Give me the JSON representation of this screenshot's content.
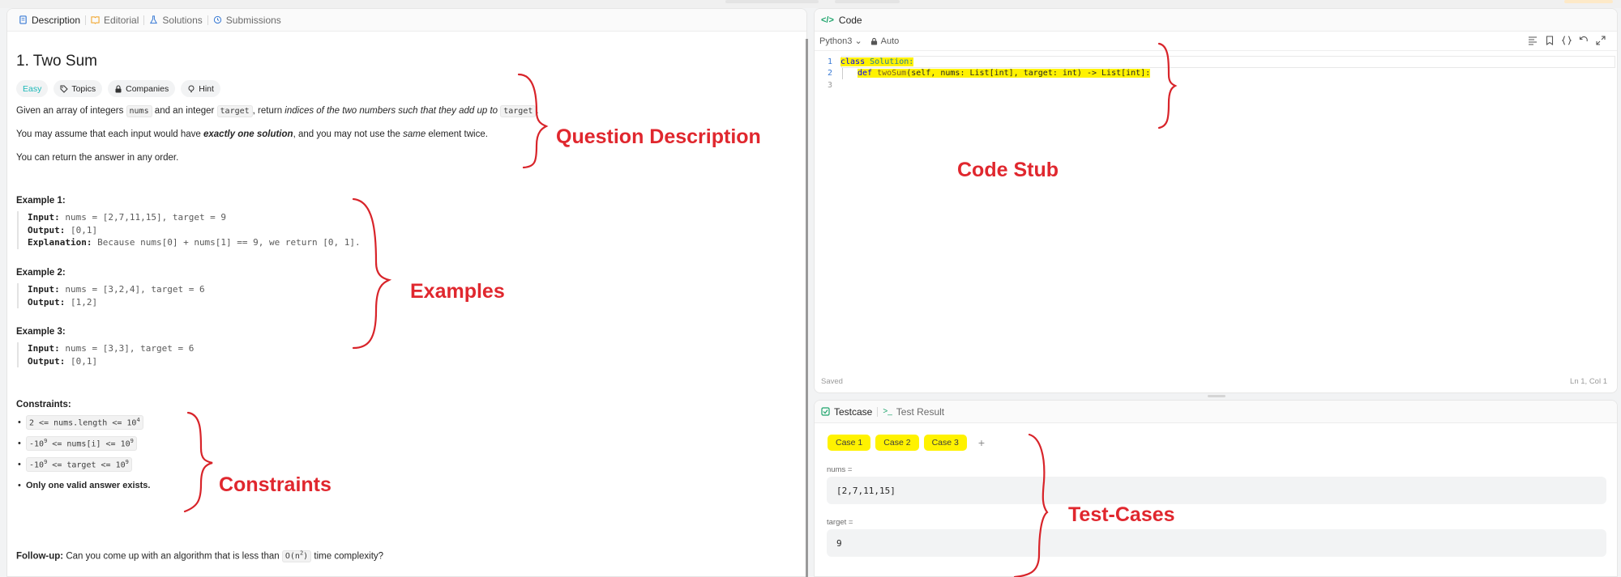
{
  "left_panel": {
    "tabs": [
      {
        "label": "Description",
        "icon": "description-icon"
      },
      {
        "label": "Editorial",
        "icon": "book-icon"
      },
      {
        "label": "Solutions",
        "icon": "flask-icon"
      },
      {
        "label": "Submissions",
        "icon": "history-icon"
      }
    ],
    "title": "1. Two Sum",
    "chips": {
      "difficulty": "Easy",
      "topics": "Topics",
      "companies": "Companies",
      "hint": "Hint"
    },
    "description": {
      "p1_pre": "Given an array of integers ",
      "p1_code1": "nums",
      "p1_mid": " and an integer ",
      "p1_code2": "target",
      "p1_mid2": ", return ",
      "p1_em": "indices of the two numbers such that they add up to",
      "p1_code3": "target",
      "p1_end": ".",
      "p2_pre": "You may assume that each input would have ",
      "p2_bold": "exactly one solution",
      "p2_mid": ", and you may not use the ",
      "p2_em": "same",
      "p2_end": " element twice.",
      "p3": "You can return the answer in any order."
    },
    "examples": [
      {
        "heading": "Example 1:",
        "input": "nums = [2,7,11,15], target = 9",
        "output": "[0,1]",
        "explanation": "Because nums[0] + nums[1] == 9, we return [0, 1]."
      },
      {
        "heading": "Example 2:",
        "input": "nums = [3,2,4], target = 6",
        "output": "[1,2]"
      },
      {
        "heading": "Example 3:",
        "input": "nums = [3,3], target = 6",
        "output": "[0,1]"
      }
    ],
    "labels": {
      "input": "Input:",
      "output": "Output:",
      "explanation": "Explanation:"
    },
    "constraints_heading": "Constraints:",
    "constraints": {
      "c1_a": "2 <= nums.length <= 10",
      "c1_sup": "4",
      "c2_a": "-10",
      "c2_sup1": "9",
      "c2_b": " <= nums[i] <= 10",
      "c2_sup2": "9",
      "c3_a": "-10",
      "c3_sup1": "9",
      "c3_b": " <= target <= 10",
      "c3_sup2": "9",
      "c4": "Only one valid answer exists."
    },
    "followup": {
      "label": "Follow-up:",
      "pre": " Can you come up with an algorithm that is less than ",
      "code": "O(n",
      "code_sup": "2",
      "code_end": ")",
      "post": " time complexity?"
    }
  },
  "code_panel": {
    "title": "Code",
    "language": "Python3",
    "mode": "Auto",
    "lines": [
      {
        "num": "1",
        "kw": "class",
        "rest": " Solution:"
      },
      {
        "num": "2",
        "kw": "def",
        "fn": " twoSum",
        "rest": "(self, nums: List[int], target: int) -> List[int]:"
      },
      {
        "num": "3"
      }
    ],
    "status_left": "Saved",
    "status_right": "Ln 1, Col 1"
  },
  "test_panel": {
    "tab_testcase": "Testcase",
    "tab_result": "Test Result",
    "cases": [
      "Case 1",
      "Case 2",
      "Case 3"
    ],
    "plus": "+",
    "fields": [
      {
        "label": "nums =",
        "value": "[2,7,11,15]"
      },
      {
        "label": "target =",
        "value": "9"
      }
    ]
  },
  "annotations": {
    "question": "Question Description",
    "examples": "Examples",
    "constraints": "Constraints",
    "stub": "Code Stub",
    "testcases": "Test-Cases"
  },
  "colors": {
    "annotation": "#e0272e",
    "highlight": "#fff200",
    "easy": "#1cb8b8"
  }
}
